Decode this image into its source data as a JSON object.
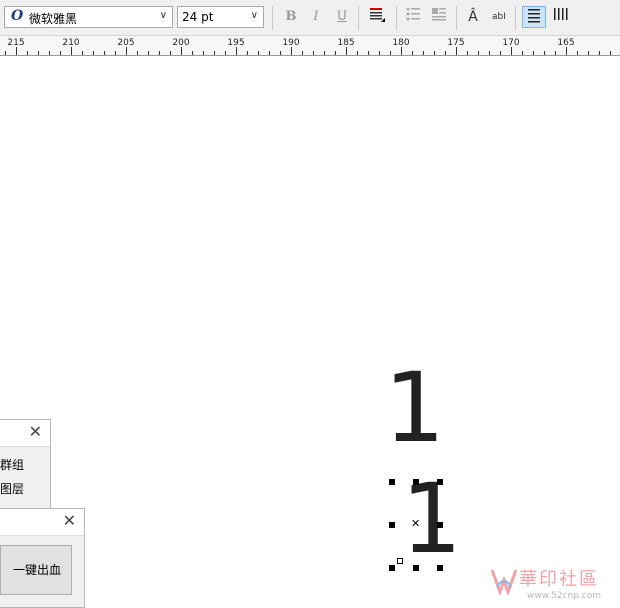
{
  "toolbar": {
    "font_family": "微软雅黑",
    "font_size": "24 pt"
  },
  "ruler": {
    "labels": [
      "215",
      "210",
      "205",
      "200",
      "195",
      "190",
      "185",
      "180",
      "175",
      "170",
      "165"
    ]
  },
  "canvas": {
    "glyph_top": "1",
    "glyph_bottom": "1"
  },
  "panel_group": {
    "items": [
      "群组",
      "图层"
    ]
  },
  "panel_bleed": {
    "button_label": "一键出血"
  },
  "watermark": {
    "text": "華印社區",
    "url": "www.52cnp.com"
  },
  "colors": {
    "toolbar_bg": "#f0f0f0",
    "selected_bg": "#cce4f7",
    "watermark": "#f1a4a8"
  }
}
